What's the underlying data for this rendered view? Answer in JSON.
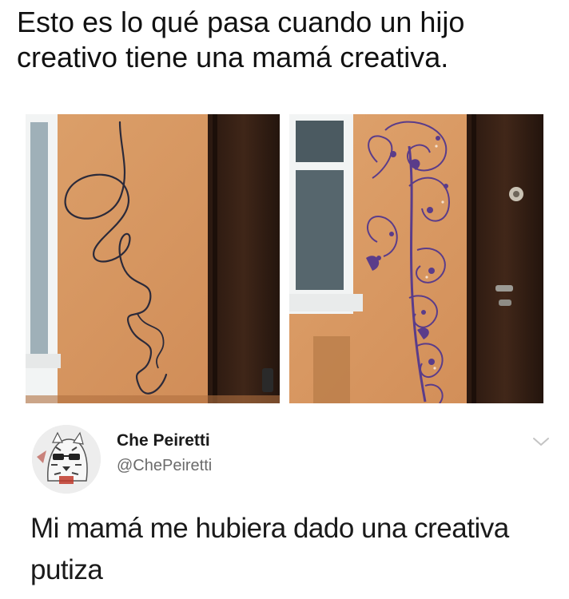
{
  "meme": {
    "caption": "Esto es lo qué pasa cuando un hijo creativo tiene una mamá creativa."
  },
  "photos": {
    "left": {
      "icon": "scribble-wall-photo"
    },
    "right": {
      "icon": "ornament-wall-photo"
    }
  },
  "tweet": {
    "display_name": "Che Peiretti",
    "handle": "@ChePeiretti",
    "text": "Mi mamá me hubiera dado una creativa putiza",
    "avatar_icon": "tiger-avatar",
    "menu_icon": "chevron-down-icon"
  },
  "colors": {
    "wall": "#d8955e",
    "door": "#3b2418",
    "window_frame": "#f1f3f3",
    "ink": "#2b2a3a",
    "ornament": "#5a3c8a",
    "handle_gray": "#6b6b6b",
    "chevron": "#c4c4c4"
  }
}
